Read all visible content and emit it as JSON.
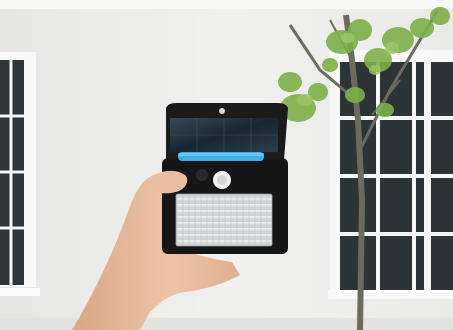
{
  "scene": {
    "subject": "solar-motion-sensor-wall-light",
    "background": "white-building-with-windows-and-young-tree",
    "colors": {
      "wall": "#ededeb",
      "top_strip": "#f7f7f6",
      "window_frame": "#f8f8f8",
      "window_glass": "#2b3436",
      "light_body": "#1a1a1a",
      "solar_panel": "#1e2a36",
      "led_strip": "#3ab0e6",
      "lens": "#dfe3e4",
      "skin": "#e6b99d",
      "leaves": "#7db04a",
      "trunk": "#6d6a5e"
    }
  }
}
